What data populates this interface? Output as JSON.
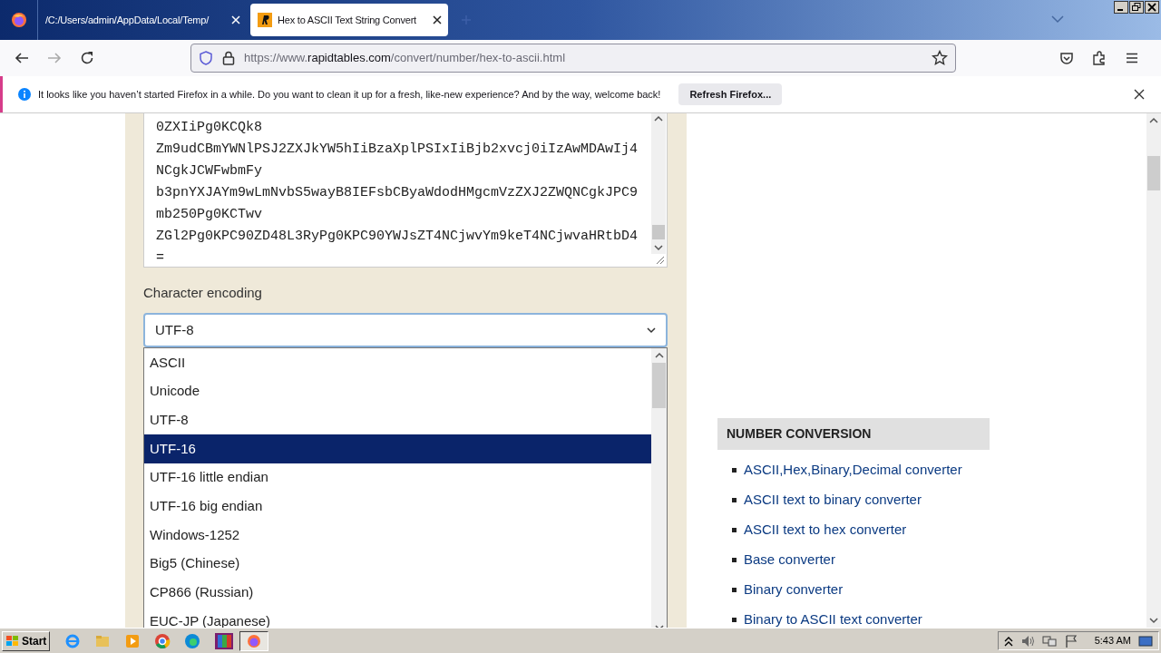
{
  "browser": {
    "tabs": [
      {
        "title": "/C:/Users/admin/AppData/Local/Temp/",
        "selected": false
      },
      {
        "title": "Hex to ASCII Text String Convert",
        "selected": true
      }
    ],
    "url": {
      "host_prefix": "https://www.",
      "host": "rapidtables.com",
      "path": "/convert/number/hex-to-ascii.html"
    },
    "notification": {
      "message": "It looks like you haven’t started Firefox in a while. Do you want to clean it up for a fresh, like-new experience? And by the way, welcome back!",
      "button": "Refresh Firefox..."
    }
  },
  "converter": {
    "text_lines": [
      "0ZXIiPg0KCQk8",
      "Zm9udCBmYWNlPSJ2ZXJkYW5hIiBzaXplPSIxIiBjb2xvcj0iIzAwMDAwIj4",
      "NCgkJCWFwbmFy",
      "b3pnYXJAYm9wLmNvbS5wayB8IEFsbCByaWdodHMgcmVzZXJ2ZWQNCgkJPC9",
      "mb250Pg0KCTwv",
      "ZGl2Pg0KPC90ZD48L3RyPg0KPC90YWJsZT4NCjwvYm9keT4NCjwvaHRtbD4",
      "="
    ],
    "encoding_label": "Character encoding",
    "encoding_value": "UTF-8",
    "options": [
      {
        "label": "ASCII",
        "selected": false
      },
      {
        "label": "Unicode",
        "selected": false
      },
      {
        "label": "UTF-8",
        "selected": false
      },
      {
        "label": "UTF-16",
        "selected": true
      },
      {
        "label": "UTF-16 little endian",
        "selected": false
      },
      {
        "label": "UTF-16 big endian",
        "selected": false
      },
      {
        "label": "Windows-1252",
        "selected": false
      },
      {
        "label": "Big5 (Chinese)",
        "selected": false
      },
      {
        "label": "CP866 (Russian)",
        "selected": false
      },
      {
        "label": "EUC-JP (Japanese)",
        "selected": false
      }
    ]
  },
  "sidebar": {
    "heading": "NUMBER CONVERSION",
    "links": [
      "ASCII,Hex,Binary,Decimal converter",
      "ASCII text to binary converter",
      "ASCII text to hex converter",
      "Base converter",
      "Binary converter",
      "Binary to ASCII text converter"
    ]
  },
  "taskbar": {
    "start": "Start",
    "clock": "5:43 AM"
  }
}
